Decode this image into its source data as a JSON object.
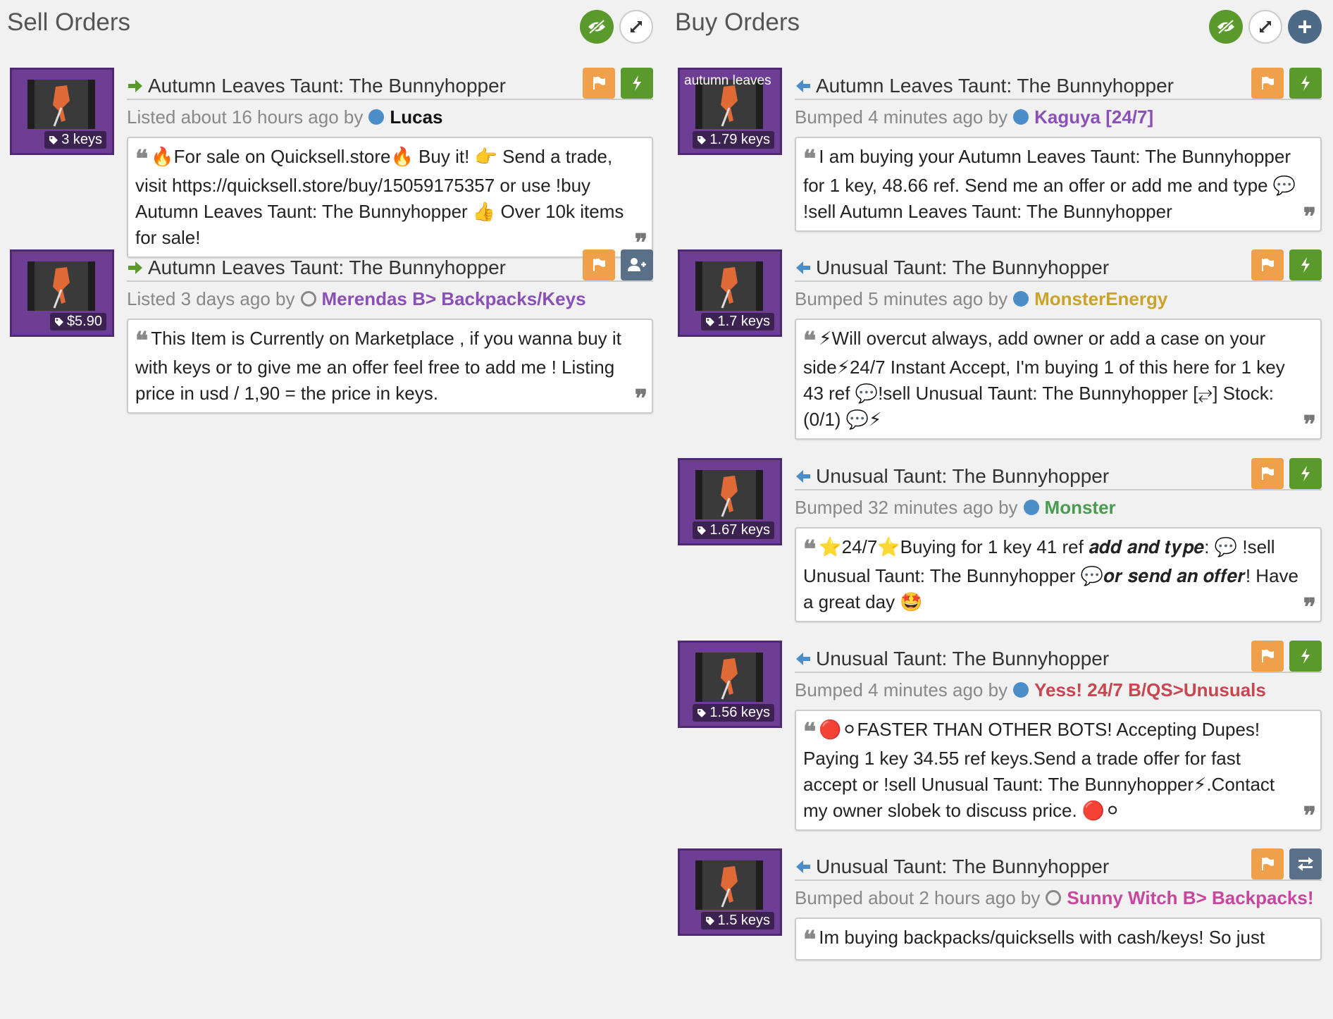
{
  "sell": {
    "title": "Sell Orders",
    "listings": [
      {
        "item_name": "Autumn Leaves Taunt: The Bunnyhopper",
        "price": "3 keys",
        "meta_prefix": "Listed about 16 hours ago by",
        "user": "Lucas",
        "user_color": "#111111",
        "user_status": "filled",
        "message": "🔥For sale on Quicksell.store🔥 Buy it! 👉 Send a trade, visit https://quicksell.store/buy/15059175357 or use !buy Autumn Leaves Taunt: The Bunnyhopper 👍 Over 10k items for sale!",
        "second_action": "lightning-icon"
      },
      {
        "item_name": "Autumn Leaves Taunt: The Bunnyhopper",
        "price": "$5.90",
        "meta_prefix": "Listed 3 days ago by",
        "user": "Merendas B> Backpacks/Keys",
        "user_color": "#8b4fb8",
        "user_status": "empty",
        "message": "This Item is Currently on Marketplace , if you wanna buy it with keys or to give me an offer feel free to add me ! Listing price in usd / 1,90 = the price in keys.",
        "second_action": "add-friend-icon"
      }
    ]
  },
  "buy": {
    "title": "Buy Orders",
    "listings": [
      {
        "item_name": "Autumn Leaves Taunt: The Bunnyhopper",
        "thumb_text": "autumn leaves",
        "price": "1.79 keys",
        "meta_prefix": "Bumped 4 minutes ago by",
        "user": "Kaguya [24/7]",
        "user_color": "#8b4fb8",
        "user_status": "filled",
        "message": "I am buying your Autumn Leaves Taunt: The Bunnyhopper for 1 key, 48.66 ref. Send me an offer or add me and type 💬 !sell Autumn Leaves Taunt: The Bunnyhopper",
        "second_action": "lightning-icon"
      },
      {
        "item_name": "Unusual Taunt: The Bunnyhopper",
        "price": "1.7 keys",
        "meta_prefix": "Bumped 5 minutes ago by",
        "user": "MonsterEnergy",
        "user_color": "#c9a32a",
        "user_status": "filled",
        "message": "⚡Will overcut always, add owner or add a case on your side⚡24/7 Instant Accept, I'm buying 1 of this here for 1 key 43 ref 💬!sell Unusual Taunt: The Bunnyhopper [⥂] Stock:(0/1) 💬⚡",
        "second_action": "lightning-icon"
      },
      {
        "item_name": "Unusual Taunt: The Bunnyhopper",
        "price": "1.67 keys",
        "meta_prefix": "Bumped 32 minutes ago by",
        "user": "Monster",
        "user_color": "#4a9a52",
        "user_status": "filled",
        "message": "⭐24/7⭐Buying for 1 key 41 ref 𝒂𝒅𝒅 𝒂𝒏𝒅 𝒕𝒚𝒑𝒆: 💬 !sell Unusual Taunt: The Bunnyhopper 💬𝒐𝒓 𝒔𝒆𝒏𝒅 𝒂𝒏 𝒐𝒇𝒇𝒆𝒓! Have a great day 🤩",
        "second_action": "lightning-icon"
      },
      {
        "item_name": "Unusual Taunt: The Bunnyhopper",
        "price": "1.56 keys",
        "meta_prefix": "Bumped 4 minutes ago by",
        "user": "Yess! 24/7 B/QS>Unusuals",
        "user_color": "#c9454f",
        "user_status": "filled",
        "message": "🔴⚪FASTER THAN OTHER BOTS! Accepting Dupes! Paying 1 key 34.55 ref keys.Send a trade offer for fast accept or !sell Unusual Taunt: The Bunnyhopper⚡.Contact my owner slobek to discuss price. 🔴⚪",
        "second_action": "lightning-icon"
      },
      {
        "item_name": "Unusual Taunt: The Bunnyhopper",
        "price": "1.5 keys",
        "meta_prefix": "Bumped about 2 hours ago by",
        "user": "Sunny Witch B> Backpacks!",
        "user_color": "#c9459e",
        "user_status": "empty",
        "message": "Im buying backpacks/quicksells with cash/keys! So just",
        "second_action": "exchange-icon"
      }
    ]
  }
}
